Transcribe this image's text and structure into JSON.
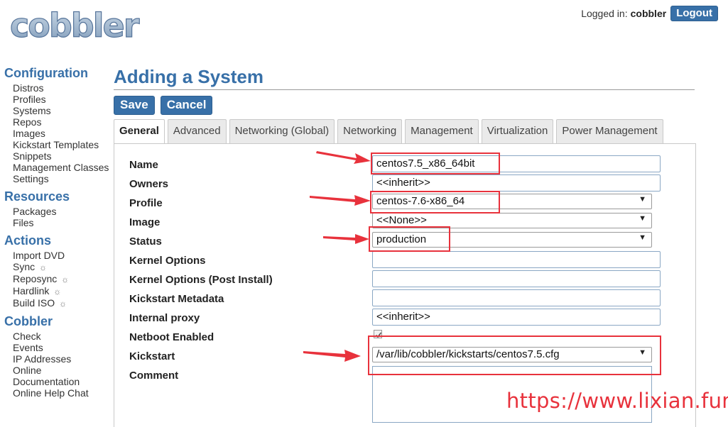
{
  "header": {
    "logo_text": "cobbler",
    "login_label": "Logged in:",
    "login_user": "cobbler",
    "logout_label": "Logout"
  },
  "sidebar": {
    "configuration": {
      "heading": "Configuration",
      "items": [
        "Distros",
        "Profiles",
        "Systems",
        "Repos",
        "Images",
        "Kickstart Templates",
        "Snippets",
        "Management Classes",
        "Settings"
      ]
    },
    "resources": {
      "heading": "Resources",
      "items": [
        "Packages",
        "Files"
      ]
    },
    "actions": {
      "heading": "Actions",
      "items": [
        "Import DVD",
        "Sync",
        "Reposync",
        "Hardlink",
        "Build ISO"
      ]
    },
    "cobbler": {
      "heading": "Cobbler",
      "items": [
        "Check",
        "Events",
        "IP Addresses",
        "Online Documentation",
        "Online Help Chat"
      ]
    },
    "gear_glyph": "☼"
  },
  "main": {
    "title": "Adding a System",
    "save_label": "Save",
    "cancel_label": "Cancel",
    "tabs": [
      "General",
      "Advanced",
      "Networking (Global)",
      "Networking",
      "Management",
      "Virtualization",
      "Power Management"
    ],
    "active_tab": "General"
  },
  "form": {
    "name": {
      "label": "Name",
      "value": "centos7.5_x86_64bit"
    },
    "owners": {
      "label": "Owners",
      "value": "<<inherit>>"
    },
    "profile": {
      "label": "Profile",
      "value": "centos-7.6-x86_64"
    },
    "image": {
      "label": "Image",
      "value": "<<None>>"
    },
    "status": {
      "label": "Status",
      "value": "production"
    },
    "kernel_options": {
      "label": "Kernel Options",
      "value": ""
    },
    "kernel_options_post": {
      "label": "Kernel Options (Post Install)",
      "value": ""
    },
    "kickstart_metadata": {
      "label": "Kickstart Metadata",
      "value": ""
    },
    "internal_proxy": {
      "label": "Internal proxy",
      "value": "<<inherit>>"
    },
    "netboot_enabled": {
      "label": "Netboot Enabled",
      "checked": true
    },
    "kickstart": {
      "label": "Kickstart",
      "value": "/var/lib/cobbler/kickstarts/centos7.5.cfg"
    },
    "comment": {
      "label": "Comment",
      "value": ""
    }
  },
  "watermark": "https://www.lixian.fun",
  "colors": {
    "accent": "#3870a8",
    "annotation": "#e8323c"
  }
}
